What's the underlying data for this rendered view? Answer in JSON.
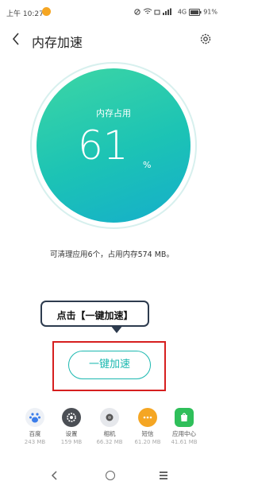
{
  "status_bar": {
    "time": "上午 10:27",
    "network": "4G",
    "battery": "91%"
  },
  "header": {
    "title": "内存加速",
    "back_icon": "chevron-left-icon",
    "settings_icon": "gear-icon"
  },
  "gauge": {
    "label": "内存占用",
    "value": "61",
    "unit": "%",
    "level": 0.61,
    "colors": [
      "#3dd6a4",
      "#15aecb"
    ]
  },
  "summary": "可清理应用6个，占用内存574 MB。",
  "callout": {
    "text": "点击【一键加速】"
  },
  "boost_button": {
    "label": "一键加速",
    "color": "#1bb8b0"
  },
  "apps": [
    {
      "name": "百度",
      "size": "243 MB",
      "icon": "baidu-paw-icon"
    },
    {
      "name": "设置",
      "size": "159 MB",
      "icon": "settings-icon"
    },
    {
      "name": "相机",
      "size": "66.32 MB",
      "icon": "camera-icon"
    },
    {
      "name": "短信",
      "size": "61.20 MB",
      "icon": "message-icon"
    },
    {
      "name": "应用中心",
      "size": "41.61 MB",
      "icon": "app-store-icon"
    }
  ],
  "highlight_color": "#d61f1f"
}
